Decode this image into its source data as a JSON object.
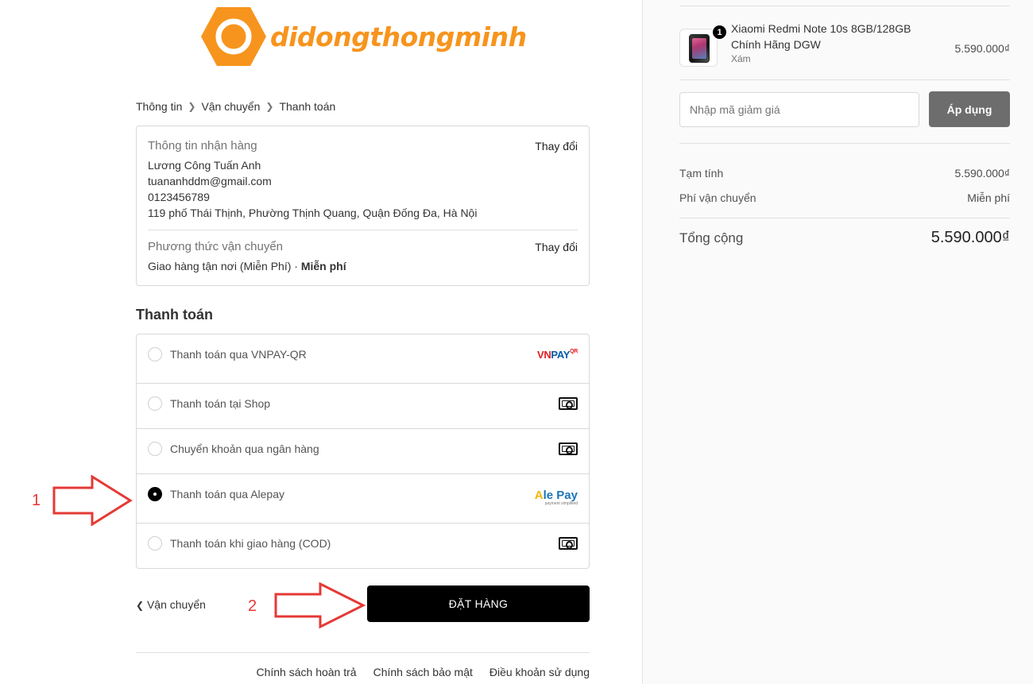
{
  "logo": {
    "text": "didongthongminh",
    "color": "#f7941d"
  },
  "breadcrumb": {
    "step1": "Thông tin",
    "step2": "Vận chuyển",
    "step3": "Thanh toán"
  },
  "shipping_info": {
    "title": "Thông tin nhận hàng",
    "change": "Thay đổi",
    "name": "Lương Công Tuấn Anh",
    "email": "tuananhddm@gmail.com",
    "phone": "0123456789",
    "address": "119 phố Thái Thịnh, Phường Thịnh Quang, Quận Đống Đa, Hà Nội"
  },
  "shipping_method": {
    "title": "Phương thức vận chuyển",
    "change": "Thay đổi",
    "method": "Giao hàng tận nơi (Miễn Phí)",
    "separator": " · ",
    "price": "Miễn phí"
  },
  "payment": {
    "title": "Thanh toán",
    "options": [
      {
        "label": "Thanh toán qua VNPAY-QR",
        "icon": "vnpay-logo-icon",
        "selected": false
      },
      {
        "label": "Thanh toán tại Shop",
        "icon": "cash-icon",
        "selected": false
      },
      {
        "label": "Chuyển khoản qua ngân hàng",
        "icon": "cash-icon",
        "selected": false
      },
      {
        "label": "Thanh toán qua Alepay",
        "icon": "alepay-logo-icon",
        "selected": true
      },
      {
        "label": "Thanh toán khi giao hàng (COD)",
        "icon": "cash-icon",
        "selected": false
      }
    ],
    "vnpay_logo": {
      "vn": "VN",
      "pay": "PAY",
      "qr": "QR"
    },
    "alepay_logo": {
      "a": "A",
      "rest": "le Pay",
      "tagline": "payment simplified"
    }
  },
  "annotations": {
    "one": "1",
    "two": "2",
    "color": "#e53935"
  },
  "actions": {
    "back": "Vận chuyển",
    "order": "ĐẶT HÀNG"
  },
  "footer": {
    "refund": "Chính sách hoàn trả",
    "privacy": "Chính sách bảo mật",
    "terms": "Điều khoản sử dụng"
  },
  "cart": {
    "product_name": "Xiaomi Redmi Note 10s 8GB/128GB Chính Hãng DGW",
    "variant": "Xám",
    "quantity": "1",
    "price": "5.590.000₫"
  },
  "discount": {
    "placeholder": "Nhập mã giảm giá",
    "apply": "Áp dụng"
  },
  "summary": {
    "subtotal_label": "Tạm tính",
    "subtotal_value": "5.590.000₫",
    "shipping_label": "Phí vận chuyển",
    "shipping_value": "Miễn phí",
    "total_label": "Tổng cộng",
    "total_value": "5.590.000₫"
  }
}
